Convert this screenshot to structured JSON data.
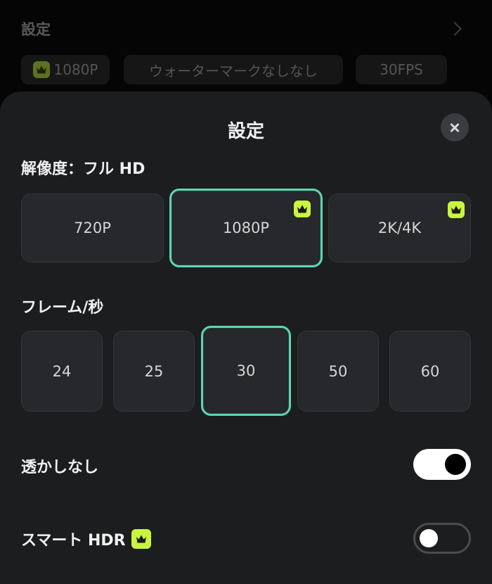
{
  "background": {
    "title": "設定",
    "chips": [
      {
        "label": "1080P",
        "has_crown": true
      },
      {
        "label": "ウォーターマークなしなし",
        "has_crown": false
      },
      {
        "label": "30FPS",
        "has_crown": false
      }
    ]
  },
  "sheet": {
    "title": "設定",
    "resolution": {
      "label": "解像度：フル HD",
      "options": [
        {
          "label": "720P",
          "selected": false,
          "premium": false
        },
        {
          "label": "1080P",
          "selected": true,
          "premium": true
        },
        {
          "label": "2K/4K",
          "selected": false,
          "premium": true
        }
      ]
    },
    "framerate": {
      "label": "フレーム/秒",
      "options": [
        {
          "label": "24",
          "selected": false
        },
        {
          "label": "25",
          "selected": false
        },
        {
          "label": "30",
          "selected": true
        },
        {
          "label": "50",
          "selected": false
        },
        {
          "label": "60",
          "selected": false
        }
      ]
    },
    "watermark": {
      "label": "透かしなし",
      "on": true
    },
    "smart_hdr": {
      "label": "スマート HDR",
      "on": false,
      "premium": true
    }
  },
  "colors": {
    "accent_selected": "#5fd4b6",
    "premium_badge": "#c9f53f"
  }
}
